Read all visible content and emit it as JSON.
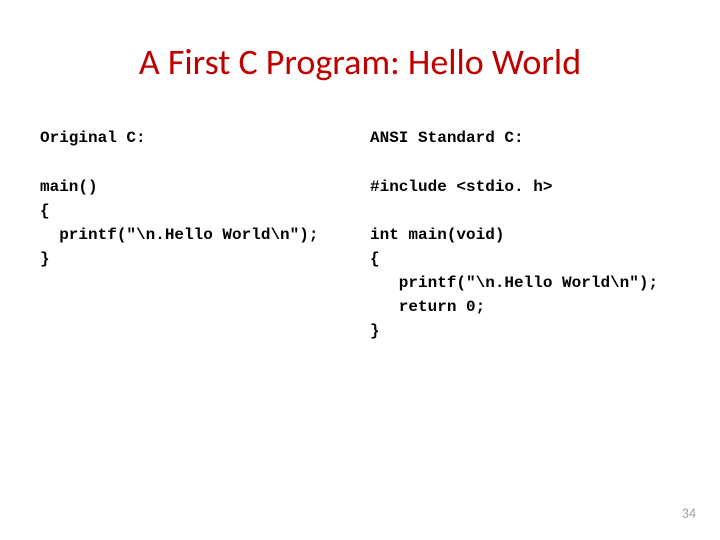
{
  "title": "A First C Program: Hello World",
  "left": {
    "header": "Original C:",
    "code": "main()\n{\n  printf(\"\\n.Hello World\\n\");\n}"
  },
  "right": {
    "header": "ANSI Standard C:",
    "code": "#include <stdio. h>\n\nint main(void)\n{\n   printf(\"\\n.Hello World\\n\");\n   return 0;\n}"
  },
  "page_number": "34"
}
